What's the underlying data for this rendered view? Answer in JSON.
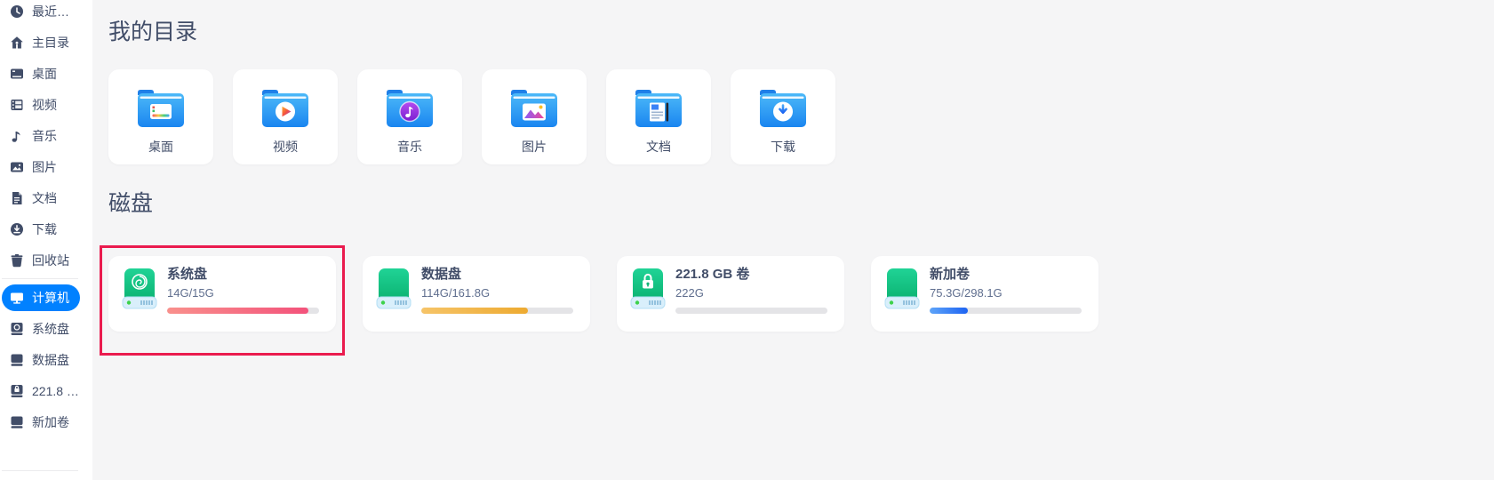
{
  "window": {
    "bg_color": "#f5f5f6",
    "sidebar_bg_color": "#ffffff",
    "accent_color": "#0181ff",
    "text_color": "#414d68",
    "secondary_text_color": "#5f6e8e"
  },
  "sidebar": {
    "items": [
      {
        "label": "最近…",
        "icon": "clock-icon",
        "selected": false
      },
      {
        "label": "主目录",
        "icon": "home-icon",
        "selected": false
      },
      {
        "label": "桌面",
        "icon": "desktop-icon",
        "selected": false
      },
      {
        "label": "视频",
        "icon": "video-icon",
        "selected": false
      },
      {
        "label": "音乐",
        "icon": "music-icon",
        "selected": false
      },
      {
        "label": "图片",
        "icon": "image-icon",
        "selected": false
      },
      {
        "label": "文档",
        "icon": "document-icon",
        "selected": false
      },
      {
        "label": "下载",
        "icon": "download-icon",
        "selected": false
      },
      {
        "label": "回收站",
        "icon": "trash-icon",
        "selected": false
      },
      {
        "label": "计算机",
        "icon": "computer-icon",
        "selected": true
      },
      {
        "label": "系统盘",
        "icon": "system-disk-icon",
        "selected": false
      },
      {
        "label": "数据盘",
        "icon": "data-disk-icon",
        "selected": false
      },
      {
        "label": "221.8 …",
        "icon": "locked-disk-icon",
        "selected": false
      },
      {
        "label": "新加卷",
        "icon": "new-volume-disk-icon",
        "selected": false
      }
    ]
  },
  "sections": {
    "directories": {
      "title": "我的目录",
      "folders": [
        {
          "label": "桌面",
          "icon": "desktop-folder-icon"
        },
        {
          "label": "视频",
          "icon": "videos-folder-icon"
        },
        {
          "label": "音乐",
          "icon": "music-folder-icon"
        },
        {
          "label": "图片",
          "icon": "pictures-folder-icon"
        },
        {
          "label": "文档",
          "icon": "documents-folder-icon"
        },
        {
          "label": "下载",
          "icon": "downloads-folder-icon"
        }
      ]
    },
    "disks": {
      "title": "磁盘",
      "items": [
        {
          "name": "系统盘",
          "usage": "14G/15G",
          "used_fraction": 0.93,
          "bar_start": "#f9908c",
          "bar_end": "#f3527b",
          "icon": "system-drive-icon",
          "highlighted": true
        },
        {
          "name": "数据盘",
          "usage": "114G/161.8G",
          "used_fraction": 0.7,
          "bar_start": "#f6c468",
          "bar_end": "#edaa31",
          "icon": "data-drive-icon",
          "highlighted": false
        },
        {
          "name": "221.8 GB 卷",
          "usage": "222G",
          "used_fraction": 0,
          "bar_start": "#e4e4e7",
          "bar_end": "#e4e4e7",
          "icon": "locked-drive-icon",
          "highlighted": false
        },
        {
          "name": "新加卷",
          "usage": "75.3G/298.1G",
          "used_fraction": 0.25,
          "bar_start": "#5ea4f9",
          "bar_end": "#1d63f2",
          "icon": "new-volume-drive-icon",
          "highlighted": false
        }
      ]
    }
  },
  "annotation": {
    "highlight_border_color": "#ea1b4e"
  }
}
